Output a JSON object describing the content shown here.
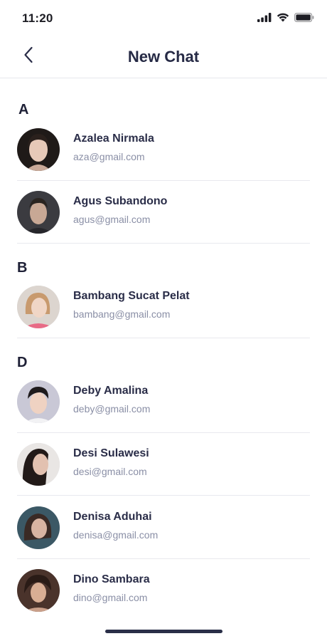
{
  "status_bar": {
    "time": "11:20",
    "icons": [
      "signal-icon",
      "wifi-icon",
      "battery-icon"
    ]
  },
  "header": {
    "title": "New Chat",
    "back_icon": "chevron-left-icon"
  },
  "sections": [
    {
      "letter": "A",
      "contacts": [
        {
          "name": "Azalea Nirmala",
          "email": "aza@gmail.com",
          "avatar_color": "#3a2f2a"
        },
        {
          "name": "Agus Subandono",
          "email": "agus@gmail.com",
          "avatar_color": "#4a4a4f"
        }
      ]
    },
    {
      "letter": "B",
      "contacts": [
        {
          "name": "Bambang Sucat Pelat",
          "email": "bambang@gmail.com",
          "avatar_color": "#c9a58a"
        }
      ]
    },
    {
      "letter": "D",
      "contacts": [
        {
          "name": "Deby Amalina",
          "email": "deby@gmail.com",
          "avatar_color": "#b7b6c6"
        },
        {
          "name": "Desi Sulawesi",
          "email": "desi@gmail.com",
          "avatar_color": "#5b4a44"
        },
        {
          "name": "Denisa Aduhai",
          "email": "denisa@gmail.com",
          "avatar_color": "#3e5560"
        },
        {
          "name": "Dino Sambara",
          "email": "dino@gmail.com",
          "avatar_color": "#5a4037"
        }
      ]
    }
  ],
  "colors": {
    "title": "#262a45",
    "name": "#2a2d48",
    "email": "#8a8fa6",
    "divider": "#e8e9ee",
    "home_indicator": "#2a2f48"
  }
}
